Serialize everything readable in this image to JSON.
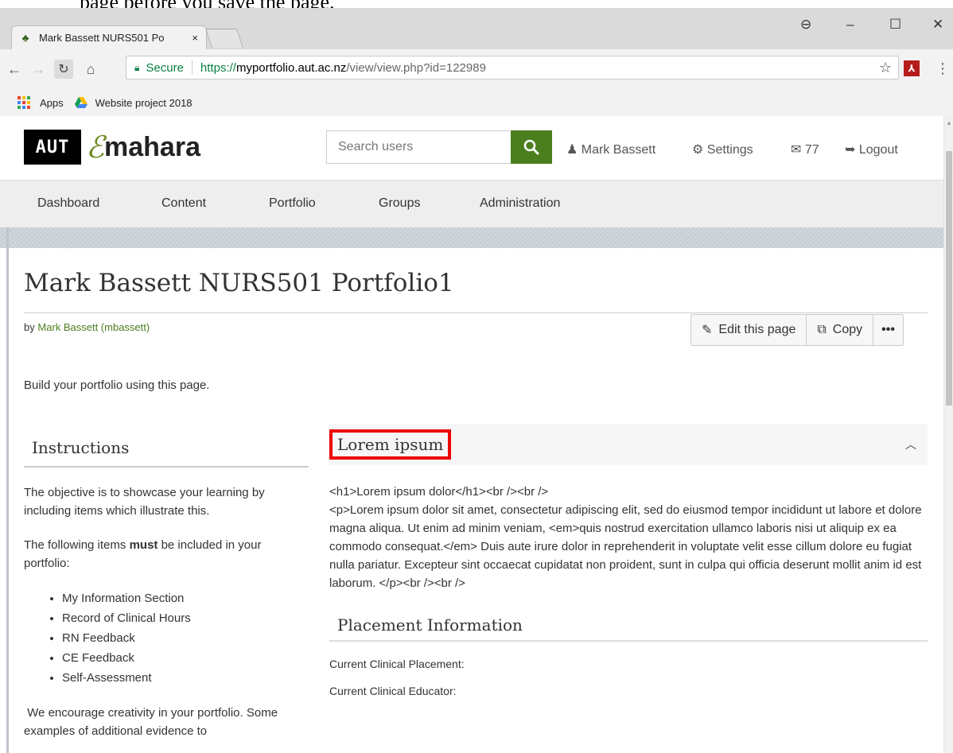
{
  "doc_snippet": "page before you save the page.",
  "browser": {
    "tab_title": "Mark Bassett NURS501 Po",
    "tab_close": "×",
    "window_controls": [
      "⊖",
      "–",
      "☐",
      "✕"
    ],
    "omnibox": {
      "secure_label": "Secure",
      "url_scheme": "https://",
      "url_host": "myportfolio.aut.ac.nz",
      "url_path": "/view/view.php?id=122989"
    },
    "bookmarks": [
      {
        "label": "Apps",
        "icon": "apps-grid-icon"
      },
      {
        "label": "Website project 2018",
        "icon": "google-drive-icon"
      }
    ]
  },
  "header": {
    "logo_aut": "AUT",
    "logo_mark": "ℰ",
    "logo_word": "mahara",
    "search_placeholder": "Search users",
    "user_name": "Mark Bassett",
    "settings_label": "Settings",
    "messages_count": "77",
    "logout_label": "Logout"
  },
  "nav": [
    "Dashboard",
    "Content",
    "Portfolio",
    "Groups",
    "Administration"
  ],
  "page": {
    "title": "Mark Bassett NURS501 Portfolio1",
    "by_prefix": "by ",
    "author_link": "Mark Bassett (mbassett)",
    "edit_label": "Edit this page",
    "copy_label": "Copy",
    "more_label": "•••",
    "intro": "Build your portfolio using this page."
  },
  "instructions": {
    "title": "Instructions",
    "p1": "The objective is to showcase your learning by including items which illustrate this.",
    "p2_before": "The following items ",
    "p2_bold": "must",
    "p2_after": " be included in your portfolio:",
    "items": [
      "My Information Section",
      "Record of Clinical Hours",
      "RN Feedback",
      "CE Feedback",
      "Self-Assessment"
    ],
    "p3": " We encourage creativity in your portfolio. Some examples of additional evidence to"
  },
  "lorem_block": {
    "title": "Lorem ipsum",
    "line1": "<h1>Lorem ipsum dolor</h1><br /><br />",
    "para": "<p>Lorem ipsum dolor sit amet, consectetur adipiscing elit, sed do eiusmod tempor incididunt ut labore et dolore magna aliqua. Ut enim ad minim veniam, <em>quis nostrud exercitation ullamco laboris nisi ut aliquip ex ea commodo consequat.</em> Duis aute irure dolor in reprehenderit in voluptate velit esse cillum dolore eu fugiat nulla pariatur. Excepteur sint occaecat cupidatat non proident, sunt in culpa qui officia deserunt mollit anim id est laborum. </p><br /><br />"
  },
  "placement": {
    "title": "Placement Information",
    "field1": "Current Clinical Placement:",
    "field2": "Current Clinical Educator:"
  },
  "colors": {
    "accent_green": "#4b7f1e",
    "highlight_red": "#e00000"
  }
}
